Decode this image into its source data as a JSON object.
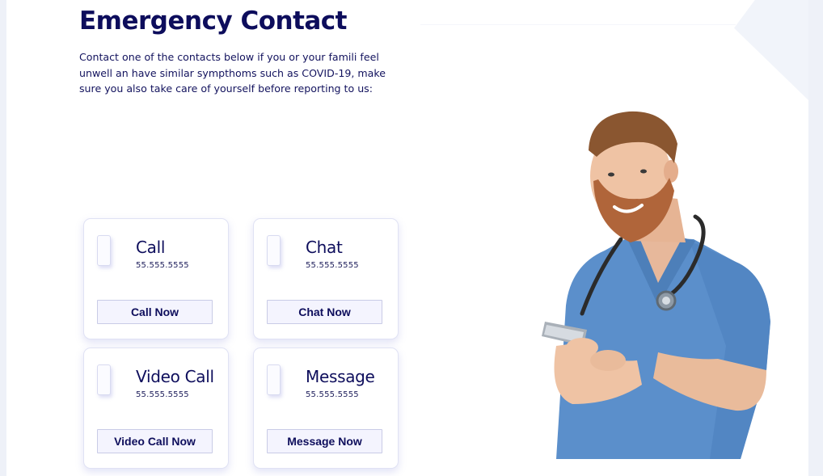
{
  "header": {
    "title": "Emergency Contact",
    "intro": "Contact one of the contacts below if you or your famili feel unwell an have similar sympthoms such as COVID-19, make sure you also take care of yourself before reporting to us:"
  },
  "contacts": [
    {
      "title": "Call",
      "phone": "55.555.5555",
      "button": "Call Now"
    },
    {
      "title": "Chat",
      "phone": "55.555.5555",
      "button": "Chat Now"
    },
    {
      "title": "Video Call",
      "phone": "55.555.5555",
      "button": "Video Call Now"
    },
    {
      "title": "Message",
      "phone": "55.555.5555",
      "button": "Message Now"
    }
  ],
  "colors": {
    "heading": "#0d0d5c",
    "button_bg": "#f4f4fe",
    "card_shadow": "#767ad6",
    "scrubs": "#5b8fcb"
  },
  "illustration": {
    "icon": "doctor-with-phone-icon"
  }
}
